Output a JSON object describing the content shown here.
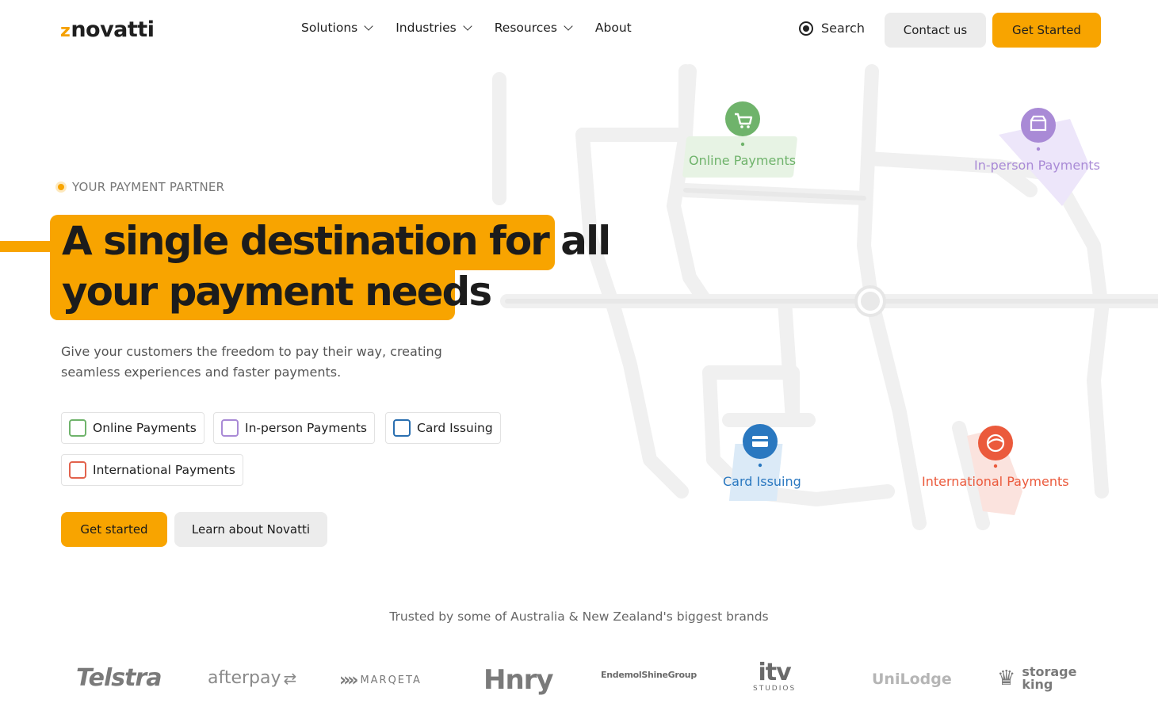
{
  "header": {
    "logo_text": "novatti",
    "nav": [
      {
        "label": "Solutions",
        "dropdown": true
      },
      {
        "label": "Industries",
        "dropdown": true
      },
      {
        "label": "Resources",
        "dropdown": true
      },
      {
        "label": "About",
        "dropdown": false
      }
    ],
    "search_label": "Search",
    "contact_label": "Contact us",
    "get_started_label": "Get Started"
  },
  "hero": {
    "tagline": "YOUR PAYMENT PARTNER",
    "headline_line1": "A single destination for all",
    "headline_line2": "your payment needs",
    "subtext": "Give your customers the freedom to pay their way, creating seamless experiences and faster payments.",
    "options": [
      {
        "label": "Online Payments",
        "color": "#6fb36b"
      },
      {
        "label": "In-person Payments",
        "color": "#a98ad6"
      },
      {
        "label": "Card Issuing",
        "color": "#2a6fb0"
      },
      {
        "label": "International Payments",
        "color": "#e2624c"
      }
    ],
    "cta_primary": "Get started",
    "cta_secondary": "Learn about Novatti"
  },
  "map": {
    "pins": [
      {
        "label": "Online Payments",
        "color": "#6fb36b",
        "icon": "cart-icon"
      },
      {
        "label": "In-person Payments",
        "color": "#a98ad6",
        "icon": "store-icon"
      },
      {
        "label": "Card Issuing",
        "color": "#2a78c0",
        "icon": "card-icon"
      },
      {
        "label": "International Payments",
        "color": "#eb5a3c",
        "icon": "globe-icon"
      }
    ]
  },
  "brands": {
    "heading": "Trusted by some of Australia & New Zealand's biggest brands",
    "logos": [
      "Telstra",
      "afterpay",
      "MARQETA",
      "Hnry",
      "EndemolShineGroup",
      "itv",
      "STUDIOS",
      "UniLodge",
      "storage",
      "king"
    ]
  },
  "colors": {
    "accent": "#f8a400",
    "button_grey": "#ececec"
  }
}
